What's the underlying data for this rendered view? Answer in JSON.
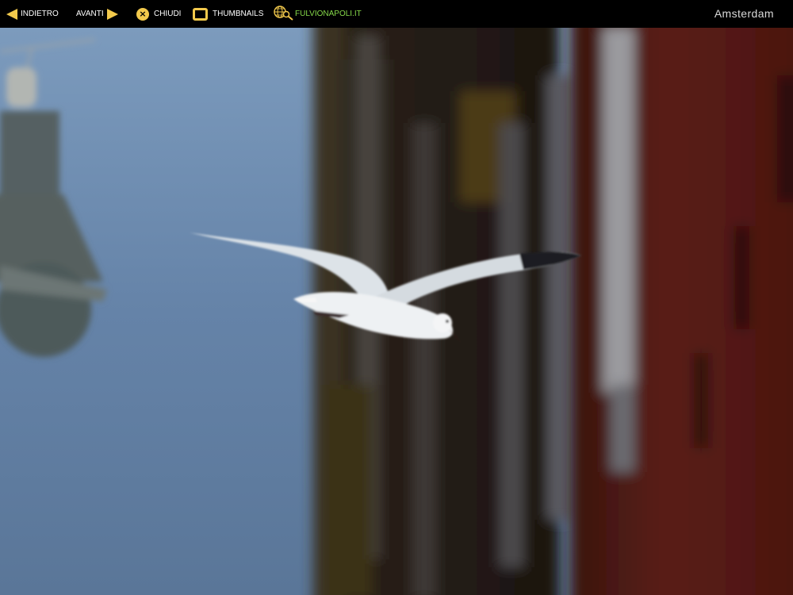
{
  "nav": {
    "back_label": "INDIETRO",
    "forward_label": "AVANTI",
    "close_label": "CHIUDI",
    "thumbnails_label": "THUMBNAILS",
    "site_label": "FULVIONAPOLI.IT"
  },
  "page": {
    "title": "Amsterdam"
  },
  "photo": {
    "icon": "seagull-photo"
  },
  "colors": {
    "accent": "#f2c94c",
    "site_link": "#86d94a",
    "bar_bg": "#000000"
  }
}
